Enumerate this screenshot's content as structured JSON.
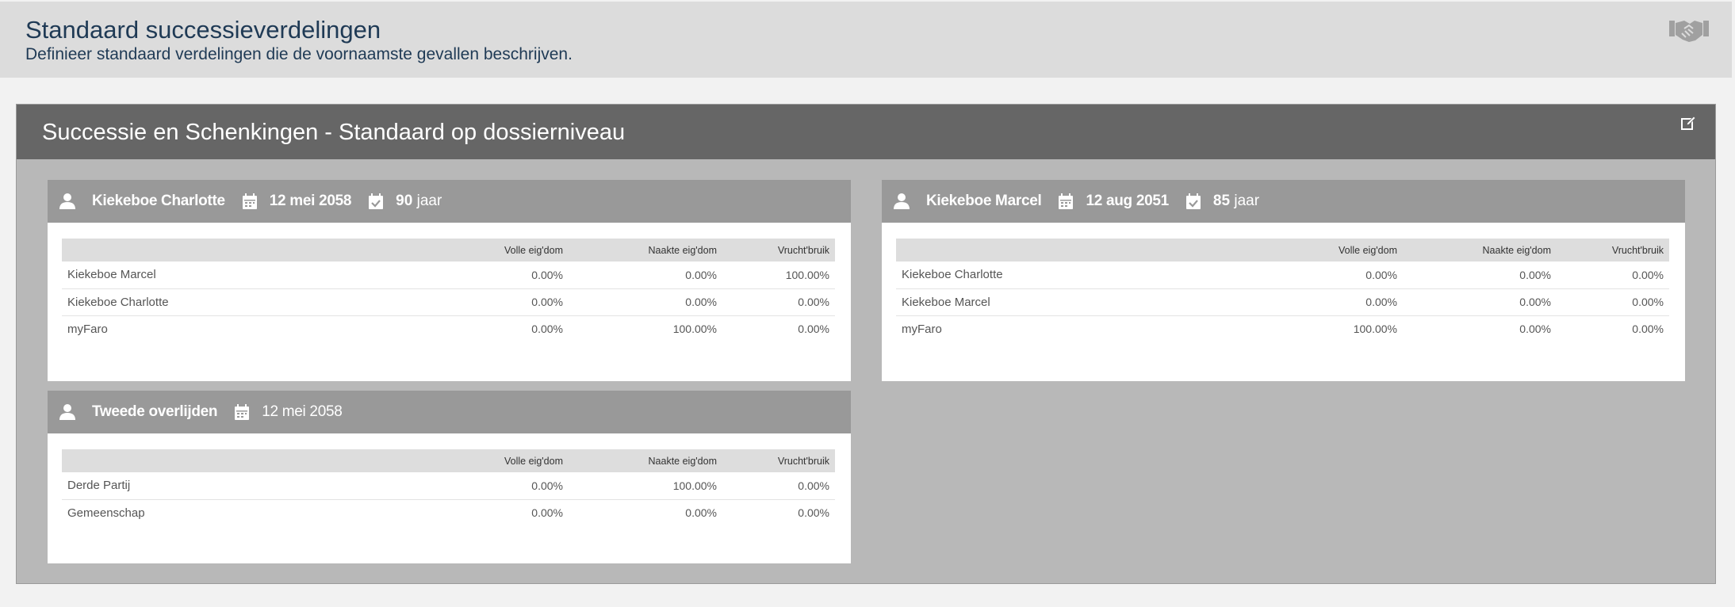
{
  "header": {
    "title": "Standaard successieverdelingen",
    "subtitle": "Definieer standaard verdelingen die de voornaamste gevallen beschrijven.",
    "icon": "handshake-icon"
  },
  "panel": {
    "title": "Successie en Schenkingen - Standaard op dossierniveau",
    "edit_icon": "edit-icon"
  },
  "columns": [
    "Volle eig'dom",
    "Naakte eig'dom",
    "Vrucht'bruik"
  ],
  "cards": [
    {
      "name": "Kiekeboe Charlotte",
      "date": "12 mei 2058",
      "age_num": "90",
      "age_unit": "jaar",
      "rows": [
        {
          "name": "Kiekeboe Marcel",
          "volle": "0.00%",
          "naakte": "0.00%",
          "vrucht": "100.00%"
        },
        {
          "name": "Kiekeboe Charlotte",
          "volle": "0.00%",
          "naakte": "0.00%",
          "vrucht": "0.00%"
        },
        {
          "name": "myFaro",
          "volle": "0.00%",
          "naakte": "100.00%",
          "vrucht": "0.00%"
        }
      ]
    },
    {
      "name": "Kiekeboe Marcel",
      "date": "12 aug 2051",
      "age_num": "85",
      "age_unit": "jaar",
      "rows": [
        {
          "name": "Kiekeboe Charlotte",
          "volle": "0.00%",
          "naakte": "0.00%",
          "vrucht": "0.00%"
        },
        {
          "name": "Kiekeboe Marcel",
          "volle": "0.00%",
          "naakte": "0.00%",
          "vrucht": "0.00%"
        },
        {
          "name": "myFaro",
          "volle": "100.00%",
          "naakte": "0.00%",
          "vrucht": "0.00%"
        }
      ]
    },
    {
      "name": "Tweede overlijden",
      "date": "12 mei 2058",
      "rows": [
        {
          "name": "Derde Partij",
          "volle": "0.00%",
          "naakte": "100.00%",
          "vrucht": "0.00%"
        },
        {
          "name": "Gemeenschap",
          "volle": "0.00%",
          "naakte": "0.00%",
          "vrucht": "0.00%"
        }
      ]
    }
  ],
  "colors": {
    "header_bg": "#dcdcdc",
    "title_text": "#1f3a55",
    "panel_head": "#666666",
    "panel_body": "#b8b8b8",
    "card_head": "#999999",
    "table_head": "#dddddd"
  }
}
